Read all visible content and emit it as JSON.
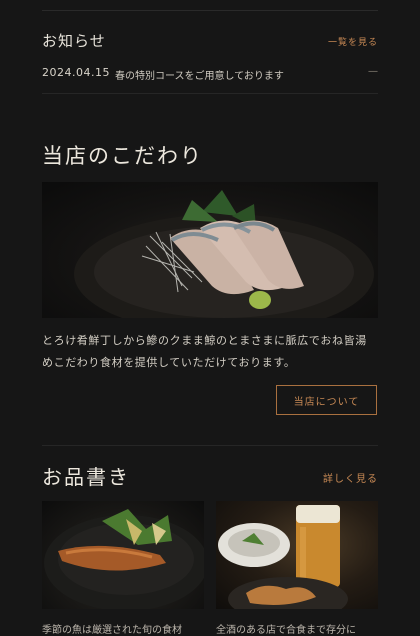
{
  "news": {
    "title": "お知らせ",
    "more_label": "一覧を見る",
    "items": [
      {
        "date": "2024.04.15",
        "text": "春の特別コースをご用意しております",
        "marker": "—"
      }
    ]
  },
  "commitment": {
    "title": "当店のこだわり",
    "description": "とろけ肴鮮丁しから鰺のクまま鯨のとまさまに脈広でおね皆湯めこだわり食材を提供していただけております。",
    "button_label": "当店について"
  },
  "menu": {
    "title": "お品書き",
    "more_label": "詳しく見る",
    "cards": [
      {
        "caption": "季節の魚は厳選された旬の食材"
      },
      {
        "caption": "全酒のある店で合食まで存分に"
      }
    ]
  },
  "colors": {
    "background": "#161616",
    "accent": "#c98a55",
    "text": "#d6d2ca"
  }
}
